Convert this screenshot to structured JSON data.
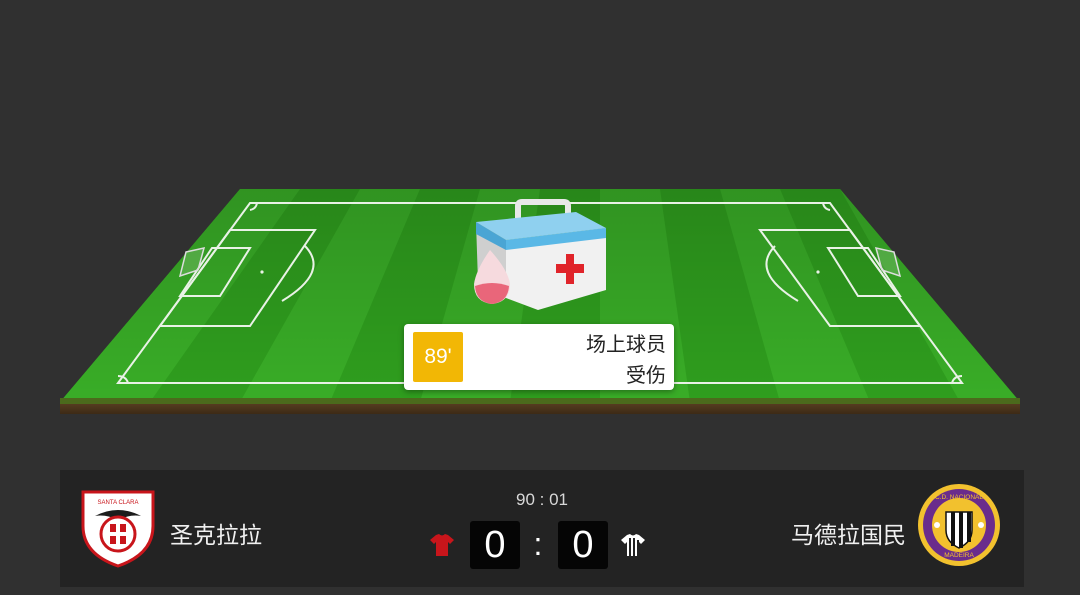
{
  "event": {
    "minute": "89'",
    "line1": "场上球员",
    "line2": "受伤",
    "icon": "medical-kit-icon"
  },
  "match": {
    "clock": "90 : 01",
    "separator": ":"
  },
  "home": {
    "name": "圣克拉拉",
    "score": "0",
    "crest_text": "SANTA CLARA",
    "kit_color": "#c8151b"
  },
  "away": {
    "name": "马德拉国民",
    "score": "0",
    "crest_text": "C.D. NACIONAL",
    "crest_text_2": "MADEIRA",
    "kit_color": "#ffffff"
  },
  "colors": {
    "pitch": "#2f9e1e",
    "badge": "#f2b705",
    "background": "#303030"
  }
}
